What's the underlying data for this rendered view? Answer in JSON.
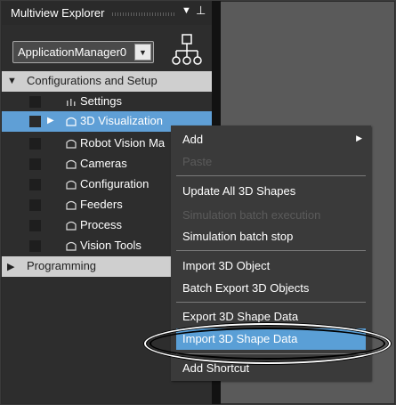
{
  "panel": {
    "title": "Multiview Explorer",
    "dropdown_value": "ApplicationManager0"
  },
  "tree": {
    "config_header": "Configurations and Setup",
    "items": [
      {
        "label": "Settings"
      },
      {
        "label": "3D Visualization"
      },
      {
        "label": "Robot Vision Ma"
      },
      {
        "label": "Cameras"
      },
      {
        "label": "Configuration"
      },
      {
        "label": "Feeders"
      },
      {
        "label": "Process"
      },
      {
        "label": "Vision Tools"
      }
    ],
    "programming_header": "Programming"
  },
  "menu": {
    "items": [
      {
        "label": "Add"
      },
      {
        "label": "Paste"
      },
      {
        "label": "Update All 3D Shapes"
      },
      {
        "label": "Simulation batch execution"
      },
      {
        "label": "Simulation batch stop"
      },
      {
        "label": "Import 3D Object"
      },
      {
        "label": "Batch Export 3D Objects"
      },
      {
        "label": "Export 3D Shape Data"
      },
      {
        "label": "Import 3D Shape Data"
      },
      {
        "label": "Add Shortcut"
      }
    ]
  },
  "colors": {
    "selection": "#5f9fd6",
    "menu_highlight": "#5a9fd6",
    "panel_bg": "#2d2d2d",
    "menu_bg": "#3a3a3a"
  },
  "icons": [
    "pin-icon",
    "dropdown-arrow-icon",
    "hierarchy-icon",
    "settings-icon",
    "folder-icon",
    "expand-arrow-icon",
    "submenu-arrow-icon"
  ]
}
